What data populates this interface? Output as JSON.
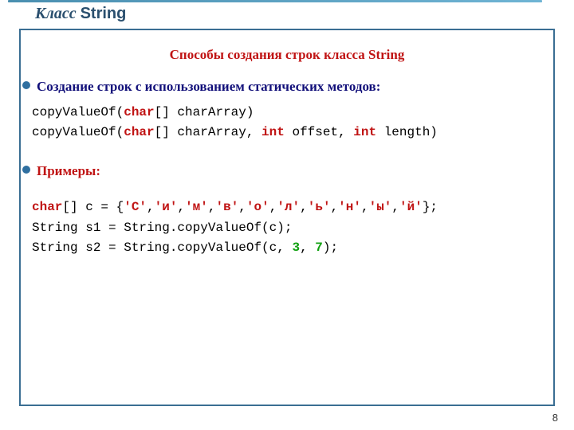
{
  "title": {
    "part1": "Класс ",
    "part2": "String"
  },
  "subtitle": "Способы создания строк  класса String",
  "bullet1": "Создание строк с  использованием  статических методов:",
  "code1": {
    "line1": {
      "seg1": "copyValueOf(",
      "seg2": "char",
      "seg3": "[] charArray)"
    },
    "line2": {
      "seg1": "copyValueOf(",
      "seg2": "char",
      "seg3": "[] charArray, ",
      "seg4": "int",
      "seg5": " offset, ",
      "seg6": "int",
      "seg7": " length)"
    }
  },
  "bullet2": "Примеры:",
  "code2": {
    "line1": {
      "seg1": "char",
      "seg2": "[] c = {",
      "seg3": "'С'",
      "seg4": ",",
      "seg5": "'и'",
      "seg6": ",",
      "seg7": "'м'",
      "seg8": ",",
      "seg9": "'в'",
      "seg10": ",",
      "seg11": "'о'",
      "seg12": ",",
      "seg13": "'л'",
      "seg14": ",",
      "seg15": "'ь'",
      "seg16": ",",
      "seg17": "'н'",
      "seg18": ",",
      "seg19": "'ы'",
      "seg20": ",",
      "seg21": "'й'",
      "seg22": "};"
    },
    "line2": "String s1 = String.copyValueOf(c);",
    "line3": {
      "seg1": "String s2 = String.copyValueOf(c, ",
      "seg2": "3",
      "seg3": ", ",
      "seg4": "7",
      "seg5": ");"
    }
  },
  "page_number": "8"
}
